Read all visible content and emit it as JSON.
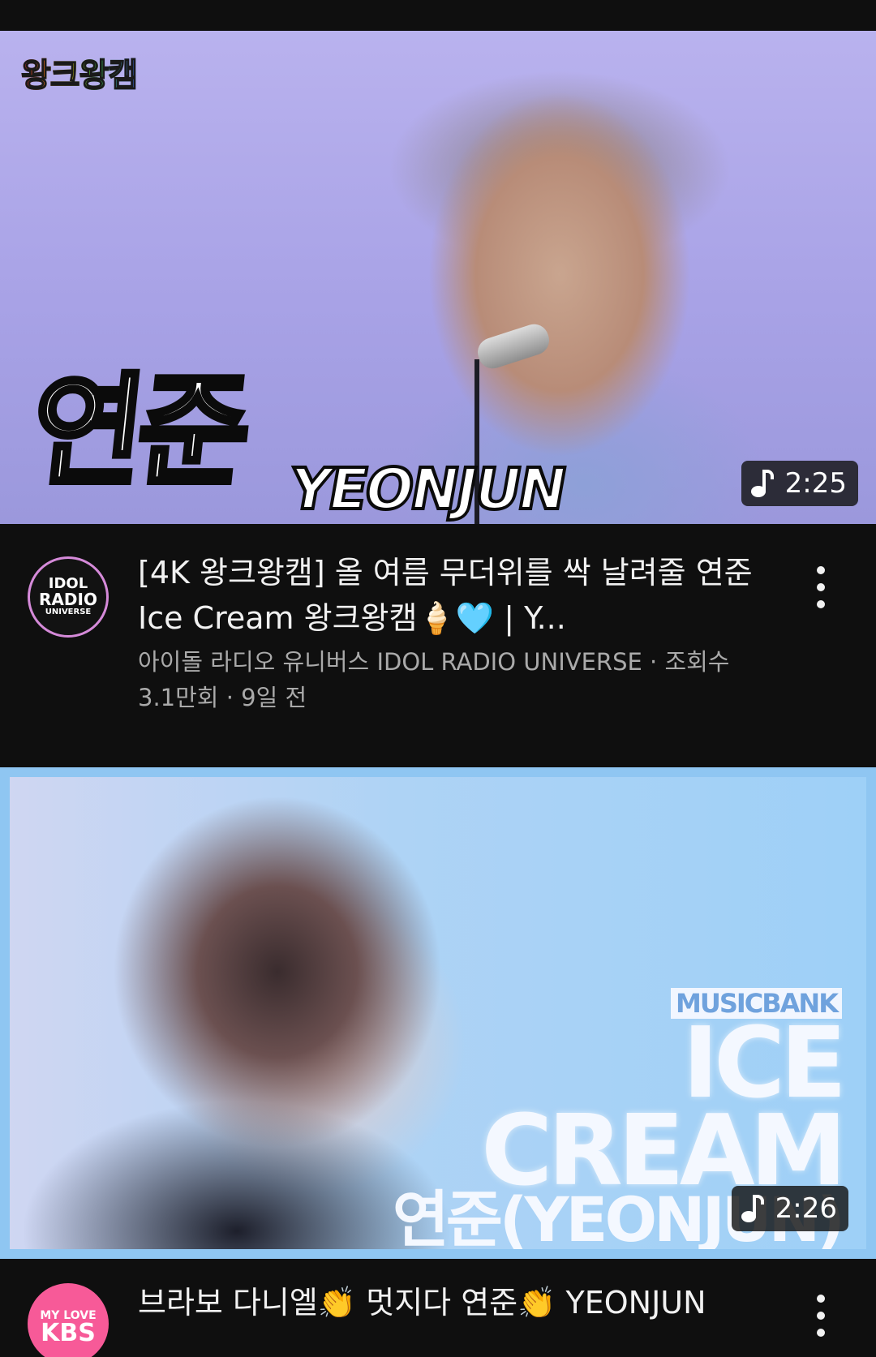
{
  "videos": [
    {
      "thumbnail": {
        "corner_logo": "왕크왕캠",
        "overlay_korean": "연준",
        "overlay_english": "YEONJUN",
        "duration": "2:25",
        "duration_icon": "music-note-icon"
      },
      "channel_avatar": {
        "line1": "IDOL",
        "line2": "RADIO",
        "line3": "UNIVERSE"
      },
      "title": "[4K 왕크왕캠] 올 여름 무더위를 싹 날려줄 연준 Ice Cream 왕크왕캠🍦🩵 | Y...",
      "meta": "아이돌 라디오 유니버스 IDOL RADIO UNIVERSE · 조회수 3.1만회 · 9일 전",
      "more_icon": "more-vert-icon"
    },
    {
      "thumbnail": {
        "show_tag": "MUSICBANK",
        "song_line1": "ICE",
        "song_line2": "CREAM",
        "artist": "연준(YEONJUN)",
        "duration": "2:26",
        "duration_icon": "music-note-icon"
      },
      "channel_avatar": {
        "line1": "MY LOVE",
        "line2": "KBS"
      },
      "title": "브라보 다니엘👏 멋지다 연준👏 YEONJUN",
      "more_icon": "more-vert-icon"
    }
  ],
  "colors": {
    "background": "#0f0f0f",
    "title_text": "#f1f1f1",
    "meta_text": "#aaaaaa",
    "duration_badge_bg": "#141414"
  }
}
